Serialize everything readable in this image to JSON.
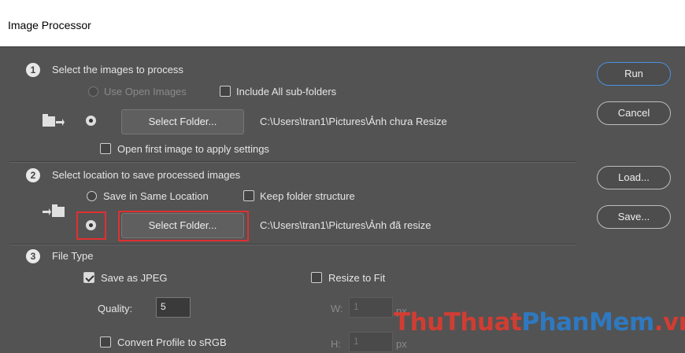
{
  "window": {
    "title": "Image Processor"
  },
  "section1": {
    "step": "1",
    "heading": "Select the images to process",
    "use_open_images": "Use Open Images",
    "include_subfolders": "Include All sub-folders",
    "select_folder_button": "Select Folder...",
    "source_path": "C:\\Users\\tran1\\Pictures\\Ảnh chưa Resize",
    "open_first_image": "Open first image to apply settings"
  },
  "section2": {
    "step": "2",
    "heading": "Select location to save processed images",
    "save_same_location": "Save in Same Location",
    "keep_folder_structure": "Keep folder structure",
    "select_folder_button": "Select Folder...",
    "dest_path": "C:\\Users\\tran1\\Pictures\\Ảnh đã resize"
  },
  "section3": {
    "step": "3",
    "heading": "File Type",
    "save_as_jpeg": "Save as JPEG",
    "resize_to_fit": "Resize to Fit",
    "quality_label": "Quality:",
    "quality_value": "5",
    "w_label": "W:",
    "w_value": "1",
    "h_label": "H:",
    "h_value": "1",
    "unit": "px",
    "convert_profile": "Convert Profile to sRGB"
  },
  "buttons": {
    "run": "Run",
    "cancel": "Cancel",
    "load": "Load...",
    "save": "Save..."
  },
  "watermark": {
    "part1": "ThuThuat",
    "part2": "PhanMem",
    "part3": ".vn"
  },
  "colors": {
    "accent": "#4a90e2",
    "highlight": "#e03030",
    "background": "#535353"
  }
}
